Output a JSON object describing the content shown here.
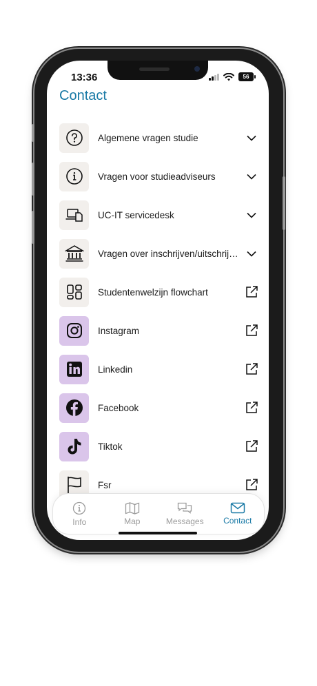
{
  "status": {
    "time": "13:36",
    "battery": "56"
  },
  "header": {
    "title": "Contact"
  },
  "items": [
    {
      "label": "Algemene vragen studie",
      "icon": "question-icon",
      "action": "chevron-down-icon"
    },
    {
      "label": "Vragen voor studieadviseurs",
      "icon": "info-icon",
      "action": "chevron-down-icon"
    },
    {
      "label": "UC-IT servicedesk",
      "icon": "laptop-document-icon",
      "action": "chevron-down-icon"
    },
    {
      "label": "Vragen over inschrijven/uitschrijven",
      "icon": "bank-icon",
      "action": "chevron-down-icon"
    },
    {
      "label": "Studentenwelzijn flowchart",
      "icon": "grid-icon",
      "action": "external-link-icon"
    },
    {
      "label": "Instagram",
      "icon": "instagram-icon",
      "action": "external-link-icon"
    },
    {
      "label": "Linkedin",
      "icon": "linkedin-icon",
      "action": "external-link-icon"
    },
    {
      "label": "Facebook",
      "icon": "facebook-icon",
      "action": "external-link-icon"
    },
    {
      "label": "Tiktok",
      "icon": "tiktok-icon",
      "action": "external-link-icon"
    },
    {
      "label": "Fsr",
      "icon": "flag-icon",
      "action": "external-link-icon"
    }
  ],
  "tabs": [
    {
      "label": "Info",
      "icon": "info-icon"
    },
    {
      "label": "Map",
      "icon": "map-icon"
    },
    {
      "label": "Messages",
      "icon": "chat-icon"
    },
    {
      "label": "Contact",
      "icon": "mail-icon",
      "active": true
    }
  ],
  "colors": {
    "accent": "#1a7aa6",
    "tile": "#f2efec",
    "social_tile": "#dac5ea"
  }
}
